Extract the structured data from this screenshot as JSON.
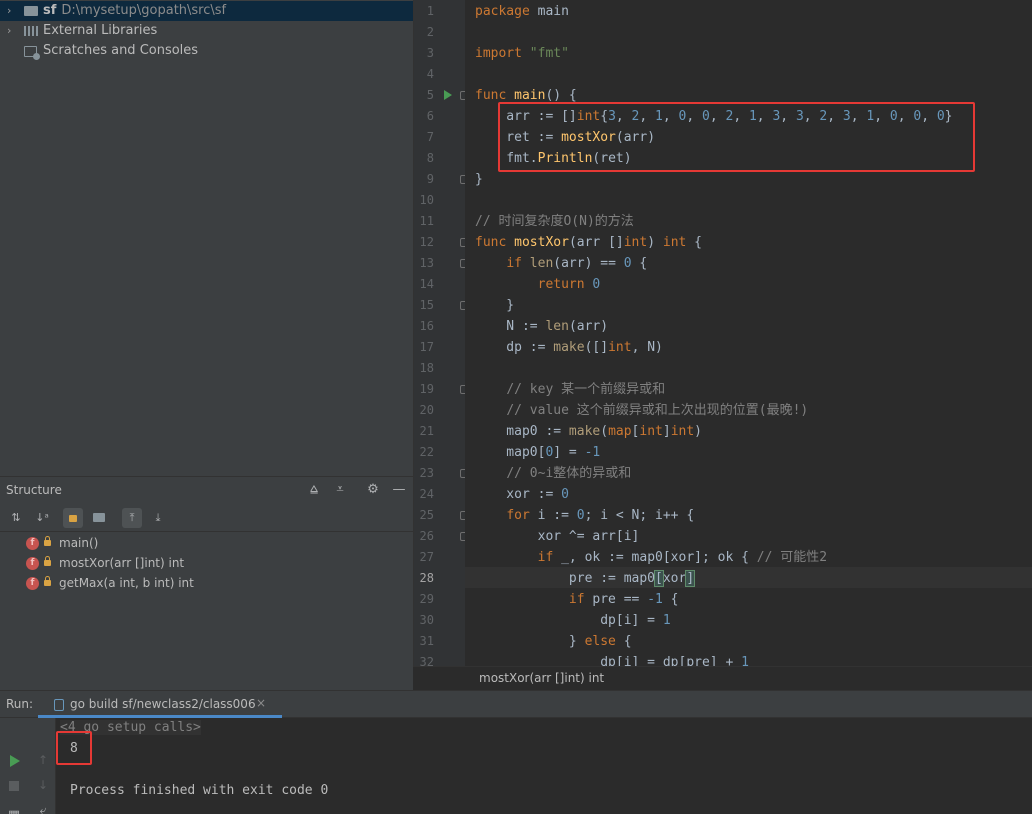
{
  "project_tree": {
    "items": [
      {
        "label": "sf",
        "path": "D:\\mysetup\\gopath\\src\\sf",
        "expandable": true
      },
      {
        "label": "External Libraries",
        "path": "",
        "expandable": true
      },
      {
        "label": "Scratches and Consoles",
        "path": "",
        "expandable": false
      }
    ]
  },
  "structure": {
    "title": "Structure",
    "items": [
      {
        "label": "main()"
      },
      {
        "label": "mostXor(arr []int) int"
      },
      {
        "label": "getMax(a int, b int) int"
      }
    ]
  },
  "editor": {
    "current_line": 28,
    "line_numbers": [
      "1",
      "2",
      "3",
      "4",
      "5",
      "6",
      "7",
      "8",
      "9",
      "10",
      "11",
      "12",
      "13",
      "14",
      "15",
      "16",
      "17",
      "18",
      "19",
      "20",
      "21",
      "22",
      "23",
      "24",
      "25",
      "26",
      "27",
      "28",
      "29",
      "30",
      "31",
      "32"
    ],
    "lines": [
      "package main",
      "",
      "import \"fmt\"",
      "",
      "func main() {",
      "    arr := []int{3, 2, 1, 0, 0, 2, 1, 3, 3, 2, 3, 1, 0, 0, 0}",
      "    ret := mostXor(arr)",
      "    fmt.Println(ret)",
      "}",
      "",
      "// 时间复杂度O(N)的方法",
      "func mostXor(arr []int) int {",
      "    if len(arr) == 0 {",
      "        return 0",
      "    }",
      "    N := len(arr)",
      "    dp := make([]int, N)",
      "",
      "    // key 某一个前缀异或和",
      "    // value 这个前缀异或和上次出现的位置(最晚!)",
      "    map0 := make(map[int]int)",
      "    map0[0] = -1",
      "    // 0~i整体的异或和",
      "    xor := 0",
      "    for i := 0; i < N; i++ {",
      "        xor ^= arr[i]",
      "        if _, ok := map0[xor]; ok { // 可能性2",
      "            pre := map0[xor]",
      "            if pre == -1 {",
      "                dp[i] = 1",
      "            } else {",
      "                dp[i] = dp[pre] + 1"
    ],
    "breadcrumb": "mostXor(arr []int) int"
  },
  "run": {
    "label": "Run:",
    "tab_title": "go build sf/newclass2/class006",
    "console": {
      "folded": "<4 go setup calls>",
      "output": "8",
      "finish": "Process finished with exit code 0"
    }
  },
  "colors": {
    "highlight_box": "#e53935",
    "keyword": "#cc7832",
    "function": "#ffc66d",
    "number": "#6897bb",
    "string": "#6a8759",
    "comment": "#808080"
  }
}
